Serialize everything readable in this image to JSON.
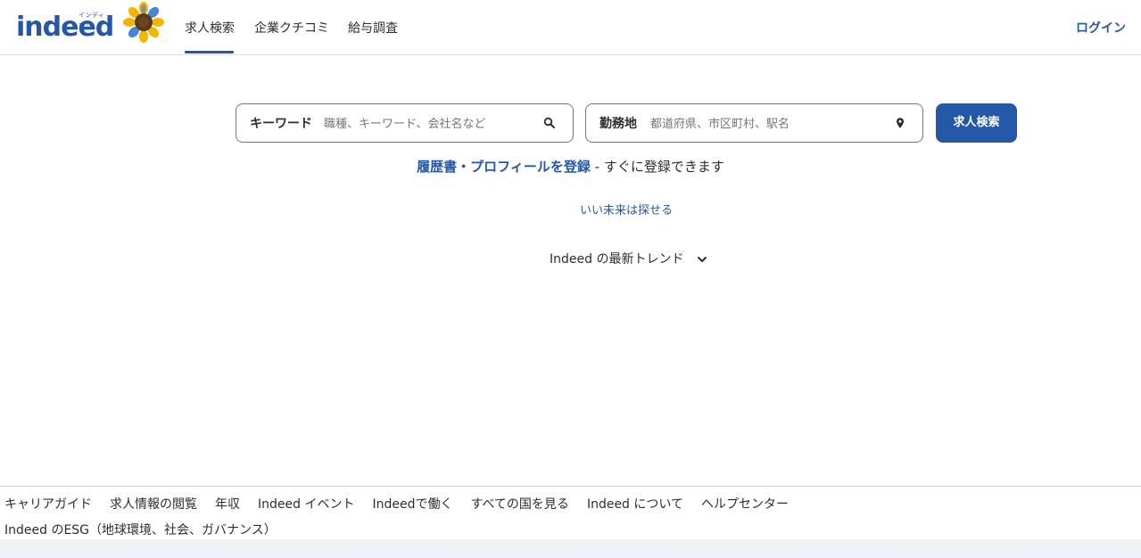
{
  "header": {
    "logo_text": "indeed",
    "logo_small": "インディード",
    "nav": [
      "求人検索",
      "企業クチコミ",
      "給与調査"
    ],
    "login": "ログイン"
  },
  "search": {
    "keyword_label": "キーワード",
    "keyword_placeholder": "職種、キーワード、会社名など",
    "location_label": "勤務地",
    "location_placeholder": "都道府県、市区町村、駅名",
    "button": "求人検索"
  },
  "resume": {
    "link": "履歴書・プロフィールを登録",
    "rest": " - すぐに登録できます"
  },
  "tagline": "いい未来は探せる",
  "trends": {
    "label": "Indeed の最新トレンド",
    "icon": "chevron-down-icon"
  },
  "footer": {
    "row1": [
      "キャリアガイド",
      "求人情報の閲覧",
      "年収",
      "Indeed イベント",
      "Indeedで働く",
      "すべての国を見る",
      "Indeed について",
      "ヘルプセンター"
    ],
    "row2": "Indeed のESG（地球環境、社会、ガバナンス）"
  },
  "colors": {
    "brand": "#2557a7",
    "text": "#2d2d2d",
    "border": "#767676"
  }
}
